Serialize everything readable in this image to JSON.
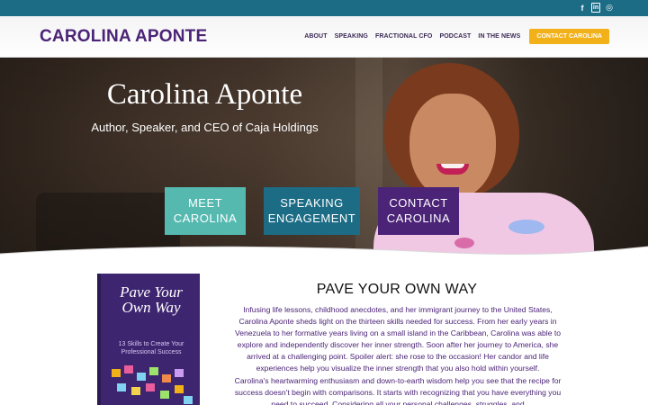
{
  "topbar": {
    "social": [
      {
        "icon": "facebook-icon",
        "glyph": "f"
      },
      {
        "icon": "linkedin-icon",
        "glyph": "in"
      },
      {
        "icon": "instagram-icon",
        "glyph": "◎"
      }
    ]
  },
  "header": {
    "logo": "CAROLINA APONTE",
    "nav": [
      "ABOUT",
      "SPEAKING",
      "FRACTIONAL CFO",
      "PODCAST",
      "IN THE NEWS"
    ],
    "cta": "CONTACT CAROLINA"
  },
  "hero": {
    "title": "Carolina Aponte",
    "subtitle": "Author, Speaker, and CEO of Caja Holdings",
    "buttons": [
      {
        "line1": "MEET",
        "line2": "CAROLINA"
      },
      {
        "line1": "SPEAKING",
        "line2": "ENGAGEMENT"
      },
      {
        "line1": "CONTACT",
        "line2": "CAROLINA"
      }
    ]
  },
  "book": {
    "title": "Pave Your Own Way",
    "subtitle": "13 Skills to Create Your Professional Success"
  },
  "section": {
    "title": "PAVE YOUR OWN WAY",
    "paragraph1": "Infusing life lessons, childhood anecdotes, and her immigrant journey to the United States, Carolina Aponte sheds light on the thirteen skills needed for success. From her early years in Venezuela to her formative years living on a small island in the Caribbean, Carolina was able to explore and independently discover her inner strength. Soon after her journey to America, she arrived at a challenging point. Spoiler alert: she rose to the occasion! Her candor and life experiences help you visualize the inner strength that you also hold within yourself.",
    "paragraph2": "Carolina's heartwarming enthusiasm and down-to-earth wisdom help you see that the recipe for success doesn't begin with comparisons. It starts with recognizing that you have everything you need to succeed. Considering all your personal challenges, struggles, and"
  },
  "colors": {
    "purple": "#4b2377",
    "teal": "#55b9b0",
    "blue": "#1c6c86",
    "gold": "#f2b019"
  }
}
